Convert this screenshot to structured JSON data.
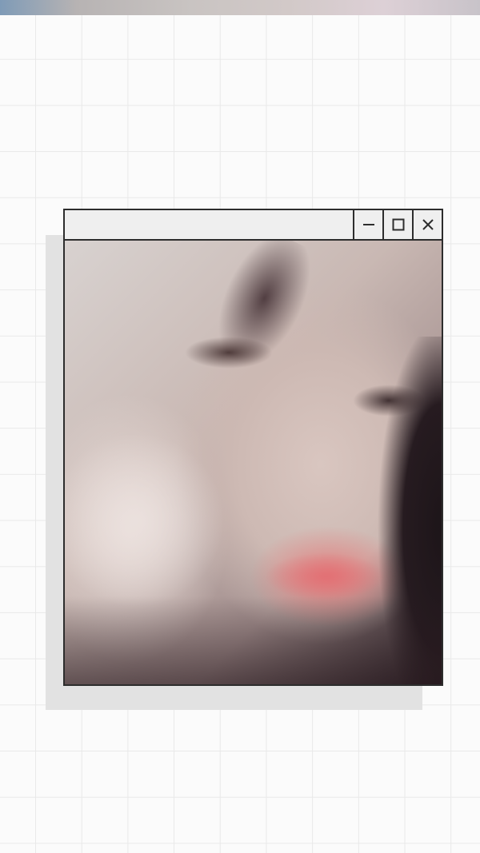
{
  "window": {
    "title": "",
    "controls": {
      "minimize_icon": "minimize-icon",
      "maximize_icon": "maximize-icon",
      "close_icon": "close-icon"
    }
  },
  "photo": {
    "alt": "selfie photo"
  },
  "colors": {
    "grid_line": "#e9e9e9",
    "window_border": "#2d2d2d",
    "titlebar_bg": "#efefef",
    "shadow": "#e2e2e2"
  }
}
